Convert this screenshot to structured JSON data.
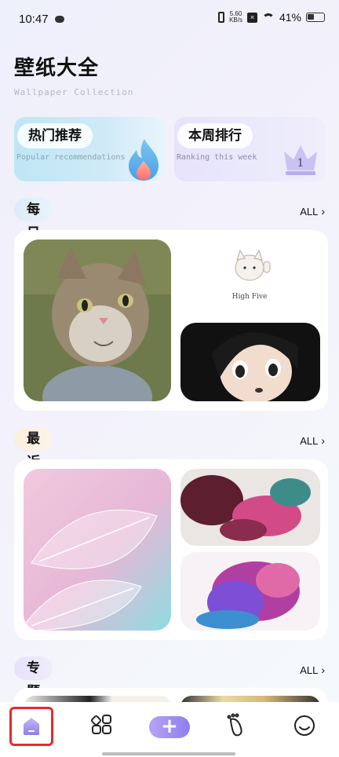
{
  "status_bar": {
    "time": "10:47",
    "net_speed_value": "5.60",
    "net_speed_unit": "KB/s",
    "battery": "41%"
  },
  "header": {
    "title": "壁纸大全",
    "subtitle": "Wallpaper Collection"
  },
  "top_cards": [
    {
      "title": "热门推荐",
      "subtitle": "Popular recommendations"
    },
    {
      "title": "本周排行",
      "subtitle": "Ranking this week",
      "rank": "1"
    }
  ],
  "sections": [
    {
      "title": "每日精选",
      "all_label": "ALL"
    },
    {
      "title": "最近更新",
      "all_label": "ALL"
    },
    {
      "title": "专题提供",
      "all_label": "ALL"
    }
  ],
  "daily": {
    "cat_caption": "High Five"
  },
  "bottom_nav": {
    "items": [
      "home-icon",
      "grid-apps-icon",
      "plus-icon",
      "footprint-icon",
      "smile-icon"
    ],
    "active": "home-icon",
    "accent": "#9b8cf2"
  }
}
